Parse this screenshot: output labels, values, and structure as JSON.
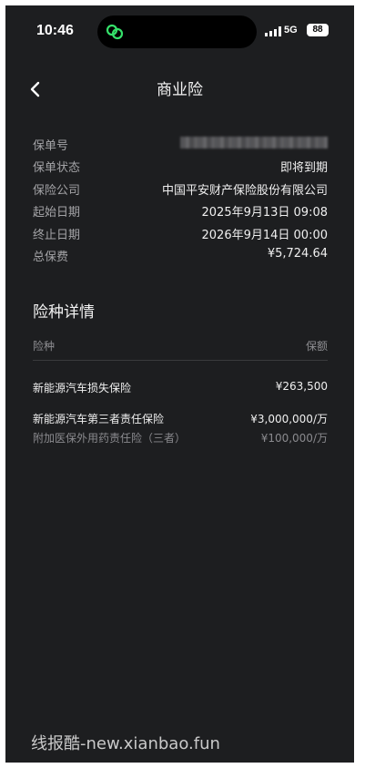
{
  "status_bar": {
    "time": "10:46",
    "network": "5G",
    "battery": "88"
  },
  "header": {
    "title": "商业险"
  },
  "policy": [
    {
      "label": "保单号",
      "value": ""
    },
    {
      "label": "保单状态",
      "value": "即将到期"
    },
    {
      "label": "保险公司",
      "value": "中国平安财产保险股份有限公司"
    },
    {
      "label": "起始日期",
      "value": "2025年9月13日 09:08"
    },
    {
      "label": "终止日期",
      "value": "2026年9月14日 00:00"
    },
    {
      "label": "总保费",
      "value": "¥5,724.64"
    }
  ],
  "coverage": {
    "title": "险种详情",
    "col_type": "险种",
    "col_amount": "保额",
    "items": [
      {
        "name": "新能源汽车损失保险",
        "amount": "¥263,500"
      },
      {
        "name": "新能源汽车第三者责任保险",
        "amount": "¥3,000,000/万"
      },
      {
        "name": "附加医保外用药责任险（三者）",
        "amount": "¥100,000/万"
      }
    ]
  },
  "watermark": "线报酷-new.xianbao.fun"
}
